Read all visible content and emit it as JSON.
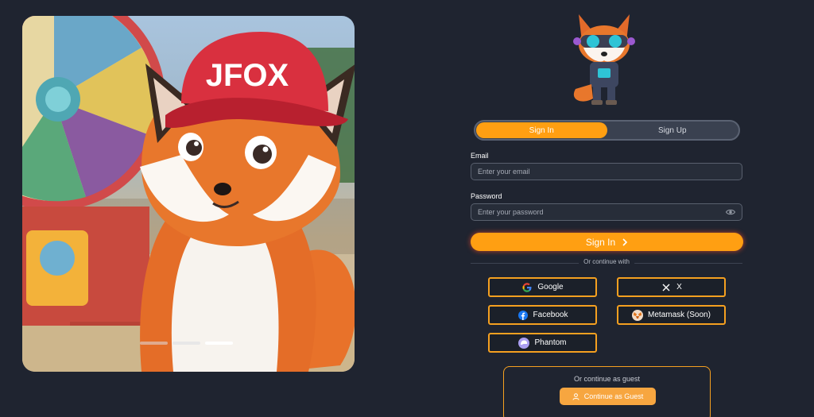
{
  "hero": {
    "cap_text": "JFOX",
    "slides": [
      false,
      false,
      true
    ]
  },
  "auth_tabs": [
    {
      "label": "Sign In",
      "active": true
    },
    {
      "label": "Sign Up",
      "active": false
    }
  ],
  "form": {
    "email_label": "Email",
    "email_placeholder": "Enter your email",
    "email_value": "",
    "password_label": "Password",
    "password_placeholder": "Enter your password",
    "password_value": "",
    "submit_label": "Sign In"
  },
  "divider_text": "Or continue with",
  "social": {
    "google": "Google",
    "x": "X",
    "facebook": "Facebook",
    "metamask": "Metamask (Soon)",
    "phantom": "Phantom"
  },
  "guest": {
    "title": "Or continue as guest",
    "button": "Continue as Guest"
  },
  "colors": {
    "background": "#1f2430",
    "accent": "#ff9f12",
    "input_bg": "#272d39"
  }
}
